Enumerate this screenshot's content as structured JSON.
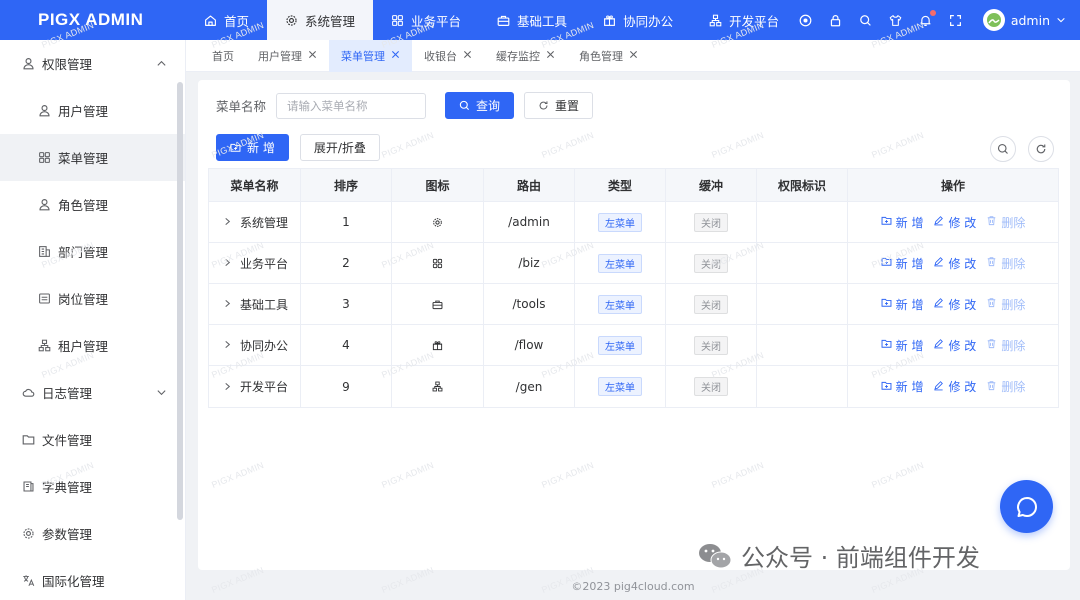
{
  "app": {
    "brand": "PIGX ADMIN",
    "watermark_text": "PIGX ADMIN"
  },
  "topnav": [
    {
      "label": "首页",
      "icon": "home-icon",
      "active": false
    },
    {
      "label": "系统管理",
      "icon": "gear-icon",
      "active": true
    },
    {
      "label": "业务平台",
      "icon": "grid-icon",
      "active": false
    },
    {
      "label": "基础工具",
      "icon": "toolbox-icon",
      "active": false
    },
    {
      "label": "协同办公",
      "icon": "gift-icon",
      "active": false
    },
    {
      "label": "开发平台",
      "icon": "hierarchy-icon",
      "active": false
    }
  ],
  "user": {
    "name": "admin"
  },
  "sidebar": {
    "items": [
      {
        "label": "权限管理",
        "level": 1,
        "icon": "user-icon",
        "expanded": true
      },
      {
        "label": "用户管理",
        "level": 2,
        "icon": "user-icon"
      },
      {
        "label": "菜单管理",
        "level": 2,
        "icon": "grid-icon",
        "active": true
      },
      {
        "label": "角色管理",
        "level": 2,
        "icon": "user-icon"
      },
      {
        "label": "部门管理",
        "level": 2,
        "icon": "building-icon"
      },
      {
        "label": "岗位管理",
        "level": 2,
        "icon": "list-icon"
      },
      {
        "label": "租户管理",
        "level": 2,
        "icon": "hierarchy-icon"
      },
      {
        "label": "日志管理",
        "level": 1,
        "icon": "cloud-icon",
        "expanded": false
      },
      {
        "label": "文件管理",
        "level": 1,
        "icon": "folder-icon"
      },
      {
        "label": "字典管理",
        "level": 1,
        "icon": "book-icon"
      },
      {
        "label": "参数管理",
        "level": 1,
        "icon": "gear-icon"
      },
      {
        "label": "国际化管理",
        "level": 1,
        "icon": "translate-icon"
      }
    ]
  },
  "tabs": [
    {
      "label": "首页",
      "closable": false,
      "active": false
    },
    {
      "label": "用户管理",
      "closable": true,
      "active": false
    },
    {
      "label": "菜单管理",
      "closable": true,
      "active": true
    },
    {
      "label": "收银台",
      "closable": true,
      "active": false
    },
    {
      "label": "缓存监控",
      "closable": true,
      "active": false
    },
    {
      "label": "角色管理",
      "closable": true,
      "active": false
    }
  ],
  "search": {
    "label": "菜单名称",
    "placeholder": "请输入菜单名称",
    "value": "",
    "query_label": "查询",
    "reset_label": "重置"
  },
  "toolbar": {
    "add_label": "新 增",
    "expand_label": "展开/折叠"
  },
  "table": {
    "columns": [
      "菜单名称",
      "排序",
      "图标",
      "路由",
      "类型",
      "缓冲",
      "权限标识",
      "操作"
    ],
    "rows": [
      {
        "name": "系统管理",
        "sort": "1",
        "icon": "gear-icon",
        "path": "/admin",
        "type": "左菜单",
        "cache": "关闭",
        "perm": ""
      },
      {
        "name": "业务平台",
        "sort": "2",
        "icon": "grid-icon",
        "path": "/biz",
        "type": "左菜单",
        "cache": "关闭",
        "perm": ""
      },
      {
        "name": "基础工具",
        "sort": "3",
        "icon": "toolbox-icon",
        "path": "/tools",
        "type": "左菜单",
        "cache": "关闭",
        "perm": ""
      },
      {
        "name": "协同办公",
        "sort": "4",
        "icon": "gift-icon",
        "path": "/flow",
        "type": "左菜单",
        "cache": "关闭",
        "perm": ""
      },
      {
        "name": "开发平台",
        "sort": "9",
        "icon": "hierarchy-icon",
        "path": "/gen",
        "type": "左菜单",
        "cache": "关闭",
        "perm": ""
      }
    ],
    "row_actions": {
      "add": "新 增",
      "edit": "修 改",
      "delete": "删除"
    }
  },
  "footer": {
    "text": "©2023 pig4cloud.com"
  },
  "overlay": {
    "wechat_text": "公众号 · 前端组件开发"
  },
  "colors": {
    "primary": "#2f66f5",
    "sidebar_active": "#f0f2f5",
    "tag_blue": "#ecf2ff"
  }
}
